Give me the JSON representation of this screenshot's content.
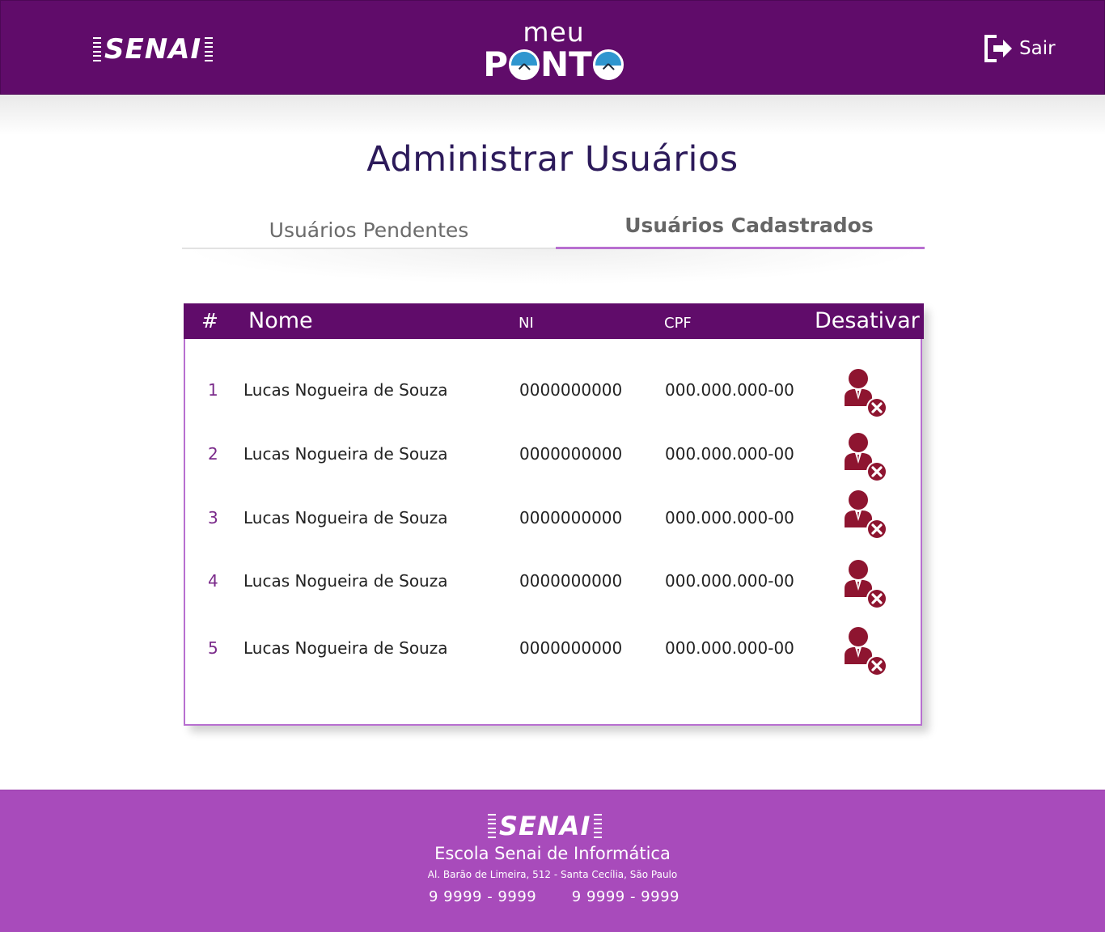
{
  "header": {
    "logo_text": "SENAI",
    "brand_top": "meu",
    "brand_bottom_left": "P",
    "brand_bottom_middle": "NT",
    "logout_label": "Sair"
  },
  "page": {
    "title": "Administrar Usuários"
  },
  "tabs": {
    "pending_label": "Usuários Pendentes",
    "registered_label": "Usuários Cadastrados",
    "active": "registered"
  },
  "table": {
    "headers": {
      "num": "#",
      "name": "Nome",
      "ni": "NI",
      "cpf": "CPF",
      "deactivate": "Desativar"
    },
    "rows": [
      {
        "num": "1",
        "name": "Lucas Nogueira de Souza",
        "ni": "0000000000",
        "cpf": "000.000.000-00",
        "icon": "remove-user-icon"
      },
      {
        "num": "2",
        "name": "Lucas Nogueira de Souza",
        "ni": "0000000000",
        "cpf": "000.000.000-00",
        "icon": "remove-user-icon"
      },
      {
        "num": "3",
        "name": "Lucas Nogueira de Souza",
        "ni": "0000000000",
        "cpf": "000.000.000-00",
        "icon": "remove-user-icon"
      },
      {
        "num": "4",
        "name": "Lucas Nogueira de Souza",
        "ni": "0000000000",
        "cpf": "000.000.000-00",
        "icon": "remove-user-icon"
      },
      {
        "num": "5",
        "name": "Lucas Nogueira de Souza",
        "ni": "0000000000",
        "cpf": "000.000.000-00",
        "icon": "remove-user-icon"
      }
    ]
  },
  "footer": {
    "logo_text": "SENAI",
    "school": "Escola Senai de Informática",
    "address": "Al. Barão de Limeira, 512 - Santa Cecília, São Paulo",
    "phone_1": "9 9999 - 9999",
    "phone_2": "9 9999 - 9999"
  },
  "colors": {
    "header_bg": "#600c6a",
    "footer_bg": "#a84bbb",
    "accent": "#b86fd0",
    "icon_red": "#8e1530",
    "title": "#2c1a5a"
  }
}
